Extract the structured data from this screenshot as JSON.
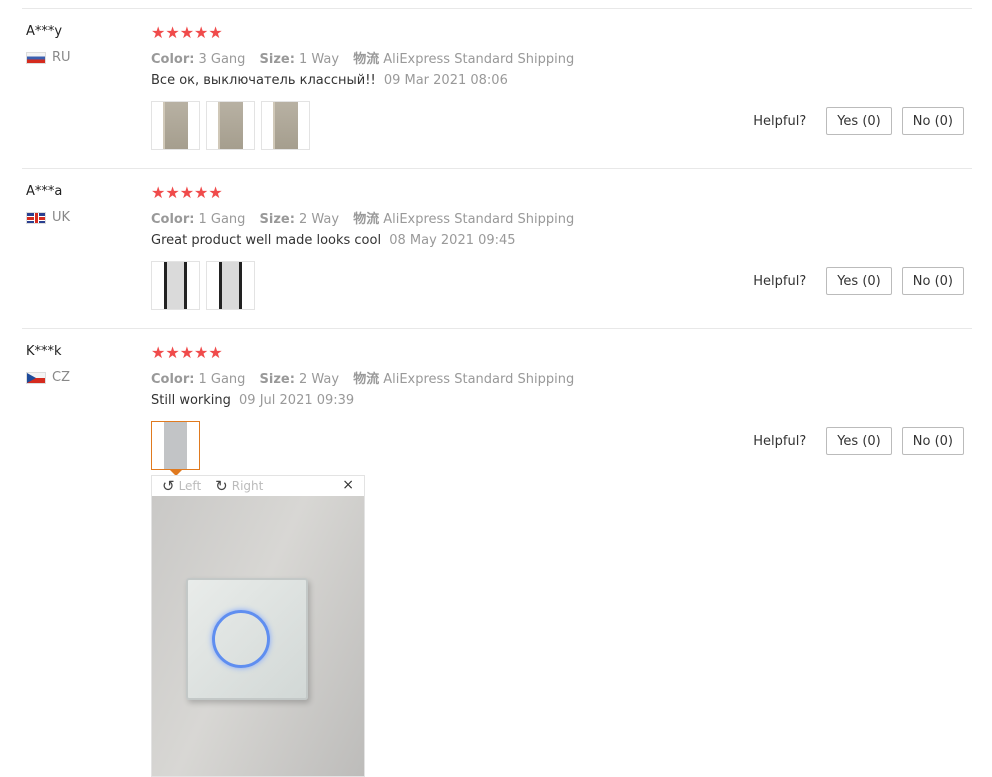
{
  "helpful_label": "Helpful?",
  "labels": {
    "color": "Color:",
    "size": "Size:",
    "logistics": "物流"
  },
  "stars": "★★★★★",
  "reviews": [
    {
      "user": "A***y",
      "country": "RU",
      "flag": "russia-flag",
      "color": "3 Gang",
      "size": "1 Way",
      "shipping": "AliExpress Standard Shipping",
      "comment": "Все ок, выключатель классный!!",
      "date": "09 Mar 2021 08:06",
      "rating": 5,
      "yes": "Yes (0)",
      "no": "No (0)",
      "photos": 3
    },
    {
      "user": "A***a",
      "country": "UK",
      "flag": "uk-flag",
      "color": "1 Gang",
      "size": "2 Way",
      "shipping": "AliExpress Standard Shipping",
      "comment": "Great product well made looks cool",
      "date": "08 May 2021 09:45",
      "rating": 5,
      "yes": "Yes (0)",
      "no": "No (0)",
      "photos": 2
    },
    {
      "user": "K***k",
      "country": "CZ",
      "flag": "czech-flag",
      "color": "1 Gang",
      "size": "2 Way",
      "shipping": "AliExpress Standard Shipping",
      "comment": "Still working",
      "date": "09 Jul 2021 09:39",
      "rating": 5,
      "yes": "Yes (0)",
      "no": "No (0)",
      "photos": 1
    }
  ],
  "viewer": {
    "rotate_left": "Left",
    "rotate_right": "Right",
    "close": "×"
  },
  "colors": {
    "star": "#f04b4b",
    "active_thumb": "#e07a1f",
    "ring": "#5f8ef0"
  }
}
